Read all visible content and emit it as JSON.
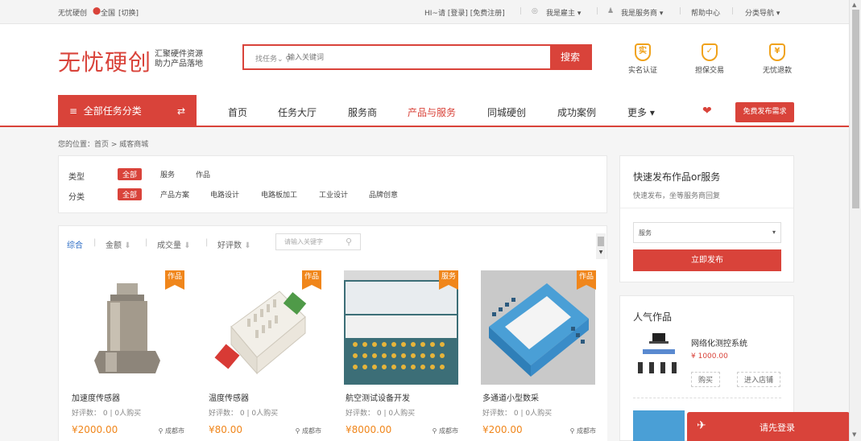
{
  "topbar": {
    "site": "无忧硬创",
    "location": "全国",
    "switch": "[切换]",
    "greeting": "HI~请 [登录] [免费注册]",
    "employer": "我是雇主",
    "provider": "我是服务商",
    "help": "帮助中心",
    "catnav": "分类导航"
  },
  "header": {
    "logo": "无忧硬创",
    "slogan_1": "汇聚硬件资源",
    "slogan_2": "助力产品落地",
    "search_type": "找任务",
    "search_placeholder": "输入关键词",
    "search_button": "搜索",
    "badges": [
      {
        "icon": "实",
        "label": "实名认证"
      },
      {
        "icon": "✓",
        "label": "担保交易"
      },
      {
        "icon": "¥",
        "label": "无忧退款"
      }
    ]
  },
  "nav": {
    "all_categories": "全部任务分类",
    "items": [
      "首页",
      "任务大厅",
      "服务商",
      "产品与服务",
      "同城硬创",
      "成功案例",
      "更多"
    ],
    "active_index": 3,
    "publish": "免费发布需求"
  },
  "breadcrumb": "您的位置：首页 > 威客商城",
  "filters": {
    "type_label": "类型",
    "type_options": [
      "全部",
      "服务",
      "作品"
    ],
    "category_label": "分类",
    "category_options": [
      "全部",
      "产品方案",
      "电路设计",
      "电路板加工",
      "工业设计",
      "品牌创意"
    ]
  },
  "sort": {
    "items": [
      "综合",
      "金额",
      "成交量",
      "好评数"
    ],
    "search_placeholder": "请输入关键字"
  },
  "products": [
    {
      "tag": "作品",
      "title": "加速度传感器",
      "rating": "好评数： 0 | 0人购买",
      "price": "¥2000.00",
      "location": "成都市"
    },
    {
      "tag": "作品",
      "title": "温度传感器",
      "rating": "好评数： 0 | 0人购买",
      "price": "¥80.00",
      "location": "成都市"
    },
    {
      "tag": "服务",
      "title": "航空测试设备开发",
      "rating": "好评数： 0 | 0人购买",
      "price": "¥8000.00",
      "location": "成都市"
    },
    {
      "tag": "作品",
      "title": "多通道小型数采",
      "rating": "好评数： 0 | 0人购买",
      "price": "¥200.00",
      "location": "成都市"
    }
  ],
  "sidebar": {
    "quick_title": "快速发布作品or服务",
    "quick_sub": "快速发布，坐等服务商回复",
    "select_value": "服务",
    "publish_button": "立即发布",
    "popular_title": "人气作品",
    "popular": {
      "title": "网络化测控系统",
      "price": "¥ 1000.00",
      "buy": "购买",
      "shop": "进入店铺"
    }
  },
  "login_bar": "请先登录"
}
